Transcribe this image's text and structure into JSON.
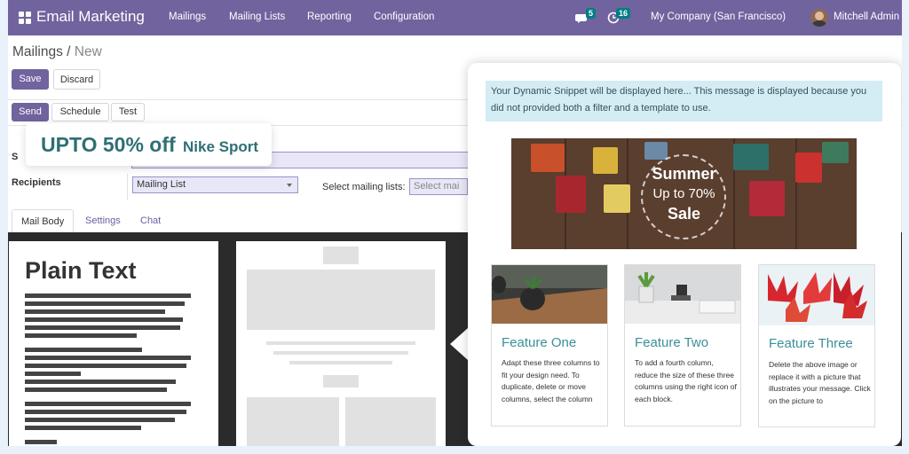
{
  "navbar": {
    "brand": "Email Marketing",
    "menu": [
      "Mailings",
      "Mailing Lists",
      "Reporting",
      "Configuration"
    ],
    "chat_count": "5",
    "activity_count": "16",
    "company": "My Company (San Francisco)",
    "user": "Mitchell Admin",
    "color": "#71639e"
  },
  "breadcrumb": {
    "parent": "Mailings",
    "sep": "/",
    "current": "New"
  },
  "buttons": {
    "save": "Save",
    "discard": "Discard",
    "send": "Send",
    "schedule": "Schedule",
    "test": "Test"
  },
  "promo": {
    "big": "UPTO 50% off",
    "small": "Nike Sport"
  },
  "form": {
    "subject_label": "S",
    "recipients_label": "Recipients",
    "recipients_value": "Mailing List",
    "select_lists_label": "Select mailing lists:",
    "select_lists_placeholder": "Select mai"
  },
  "tabs": [
    "Mail Body",
    "Settings",
    "Chat"
  ],
  "editor": {
    "plain_text_title": "Plain Text"
  },
  "popup": {
    "alert": "Your Dynamic Snippet will be displayed here... This message is displayed because you did not provided both a  filter and a template to use.",
    "banner": {
      "line1": "Summer",
      "line2": "Up to 70%",
      "line3": "Sale"
    },
    "features": [
      {
        "title": "Feature One",
        "body": "Adapt these three columns to fit your design need. To duplicate, delete or move columns, select the column"
      },
      {
        "title": "Feature Two",
        "body": "To add a fourth column, reduce the size of these three columns using the right icon of each block."
      },
      {
        "title": "Feature Three",
        "body": "Delete the above image or replace it with a picture that illustrates your message. Click on the picture to"
      }
    ],
    "side_fragment": "("
  }
}
